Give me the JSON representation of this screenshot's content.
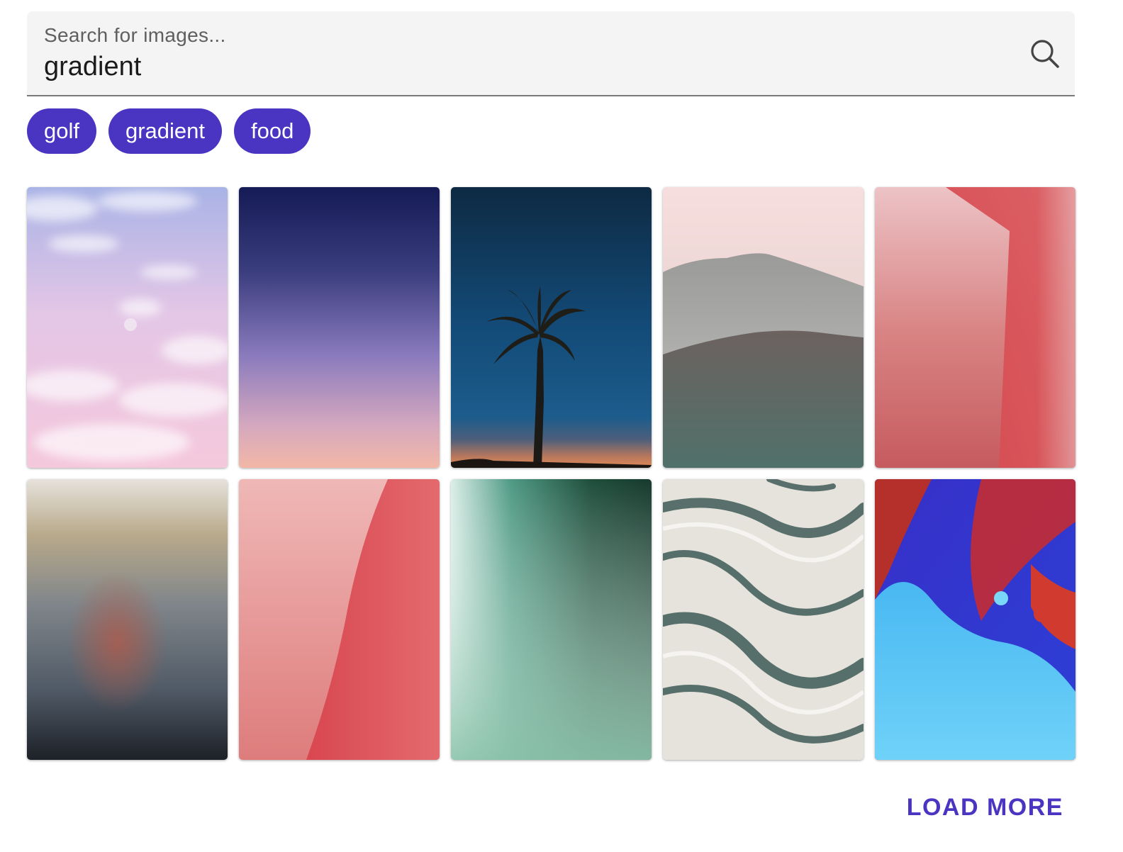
{
  "search": {
    "label": "Search for images...",
    "value": "gradient"
  },
  "chips": [
    "golf",
    "gradient",
    "food"
  ],
  "images": [
    {
      "subject": "pink-sky-clouds-image"
    },
    {
      "subject": "navy-to-peach-gradient-image"
    },
    {
      "subject": "palm-tree-night-sky-image"
    },
    {
      "subject": "misty-mountains-image"
    },
    {
      "subject": "red-wall-image"
    },
    {
      "subject": "frosted-glass-image"
    },
    {
      "subject": "pink-red-fold-image"
    },
    {
      "subject": "green-light-leak-image"
    },
    {
      "subject": "marble-swirl-image"
    },
    {
      "subject": "blue-red-fluid-art-image"
    }
  ],
  "load_more_label": "LOAD MORE",
  "colors": {
    "accent": "#4a35c2",
    "search_bg": "#f4f4f4"
  }
}
